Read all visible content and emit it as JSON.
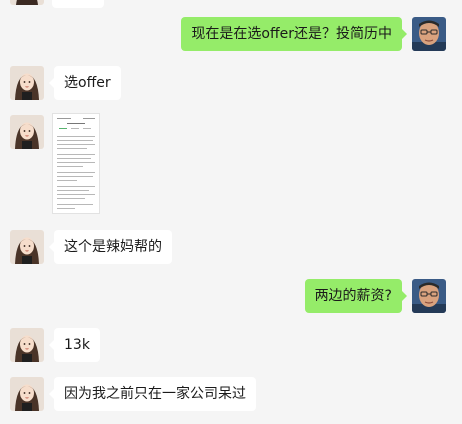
{
  "messages": [
    {
      "side": "in",
      "kind": "cropped"
    },
    {
      "side": "out",
      "text": "现在是在选offer还是？投简历中"
    },
    {
      "side": "in",
      "text": "选offer"
    },
    {
      "side": "in",
      "kind": "image"
    },
    {
      "side": "in",
      "text": "这个是辣妈帮的"
    },
    {
      "side": "out",
      "text": "两边的薪资?"
    },
    {
      "side": "in",
      "text": "13k"
    },
    {
      "side": "in",
      "text": "因为我之前只在一家公司呆过"
    }
  ],
  "colors": {
    "background": "#f5f5f5",
    "incoming_bubble": "#ffffff",
    "outgoing_bubble": "#95ec69"
  }
}
